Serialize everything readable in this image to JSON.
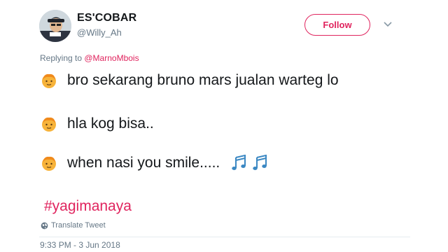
{
  "author": {
    "display_name": "ES'COBAR",
    "handle": "@Willy_Ah"
  },
  "header": {
    "follow_label": "Follow",
    "menu_icon": "chevron-down-icon"
  },
  "reply": {
    "prefix": "Replying to ",
    "mention": "@MarnoMbois"
  },
  "tweet": {
    "lines": [
      {
        "icon": "boy-face-emoji-icon",
        "text": "bro sekarang bruno mars jualan warteg lo"
      },
      {
        "icon": "boy-face-emoji-icon",
        "text": "hla kog bisa.."
      },
      {
        "icon": "boy-face-emoji-icon",
        "text": "when nasi you smile.....",
        "trailing_icons": [
          "music-notes-icon",
          "music-notes-icon"
        ]
      }
    ],
    "hashtag": "#yagimanaya"
  },
  "footer": {
    "translate_label": "Translate Tweet",
    "translate_icon": "globe-icon",
    "timestamp": "9:33 PM - 3 Jun 2018"
  },
  "colors": {
    "accent": "#e0245e",
    "text": "#14171a",
    "muted": "#657786"
  }
}
